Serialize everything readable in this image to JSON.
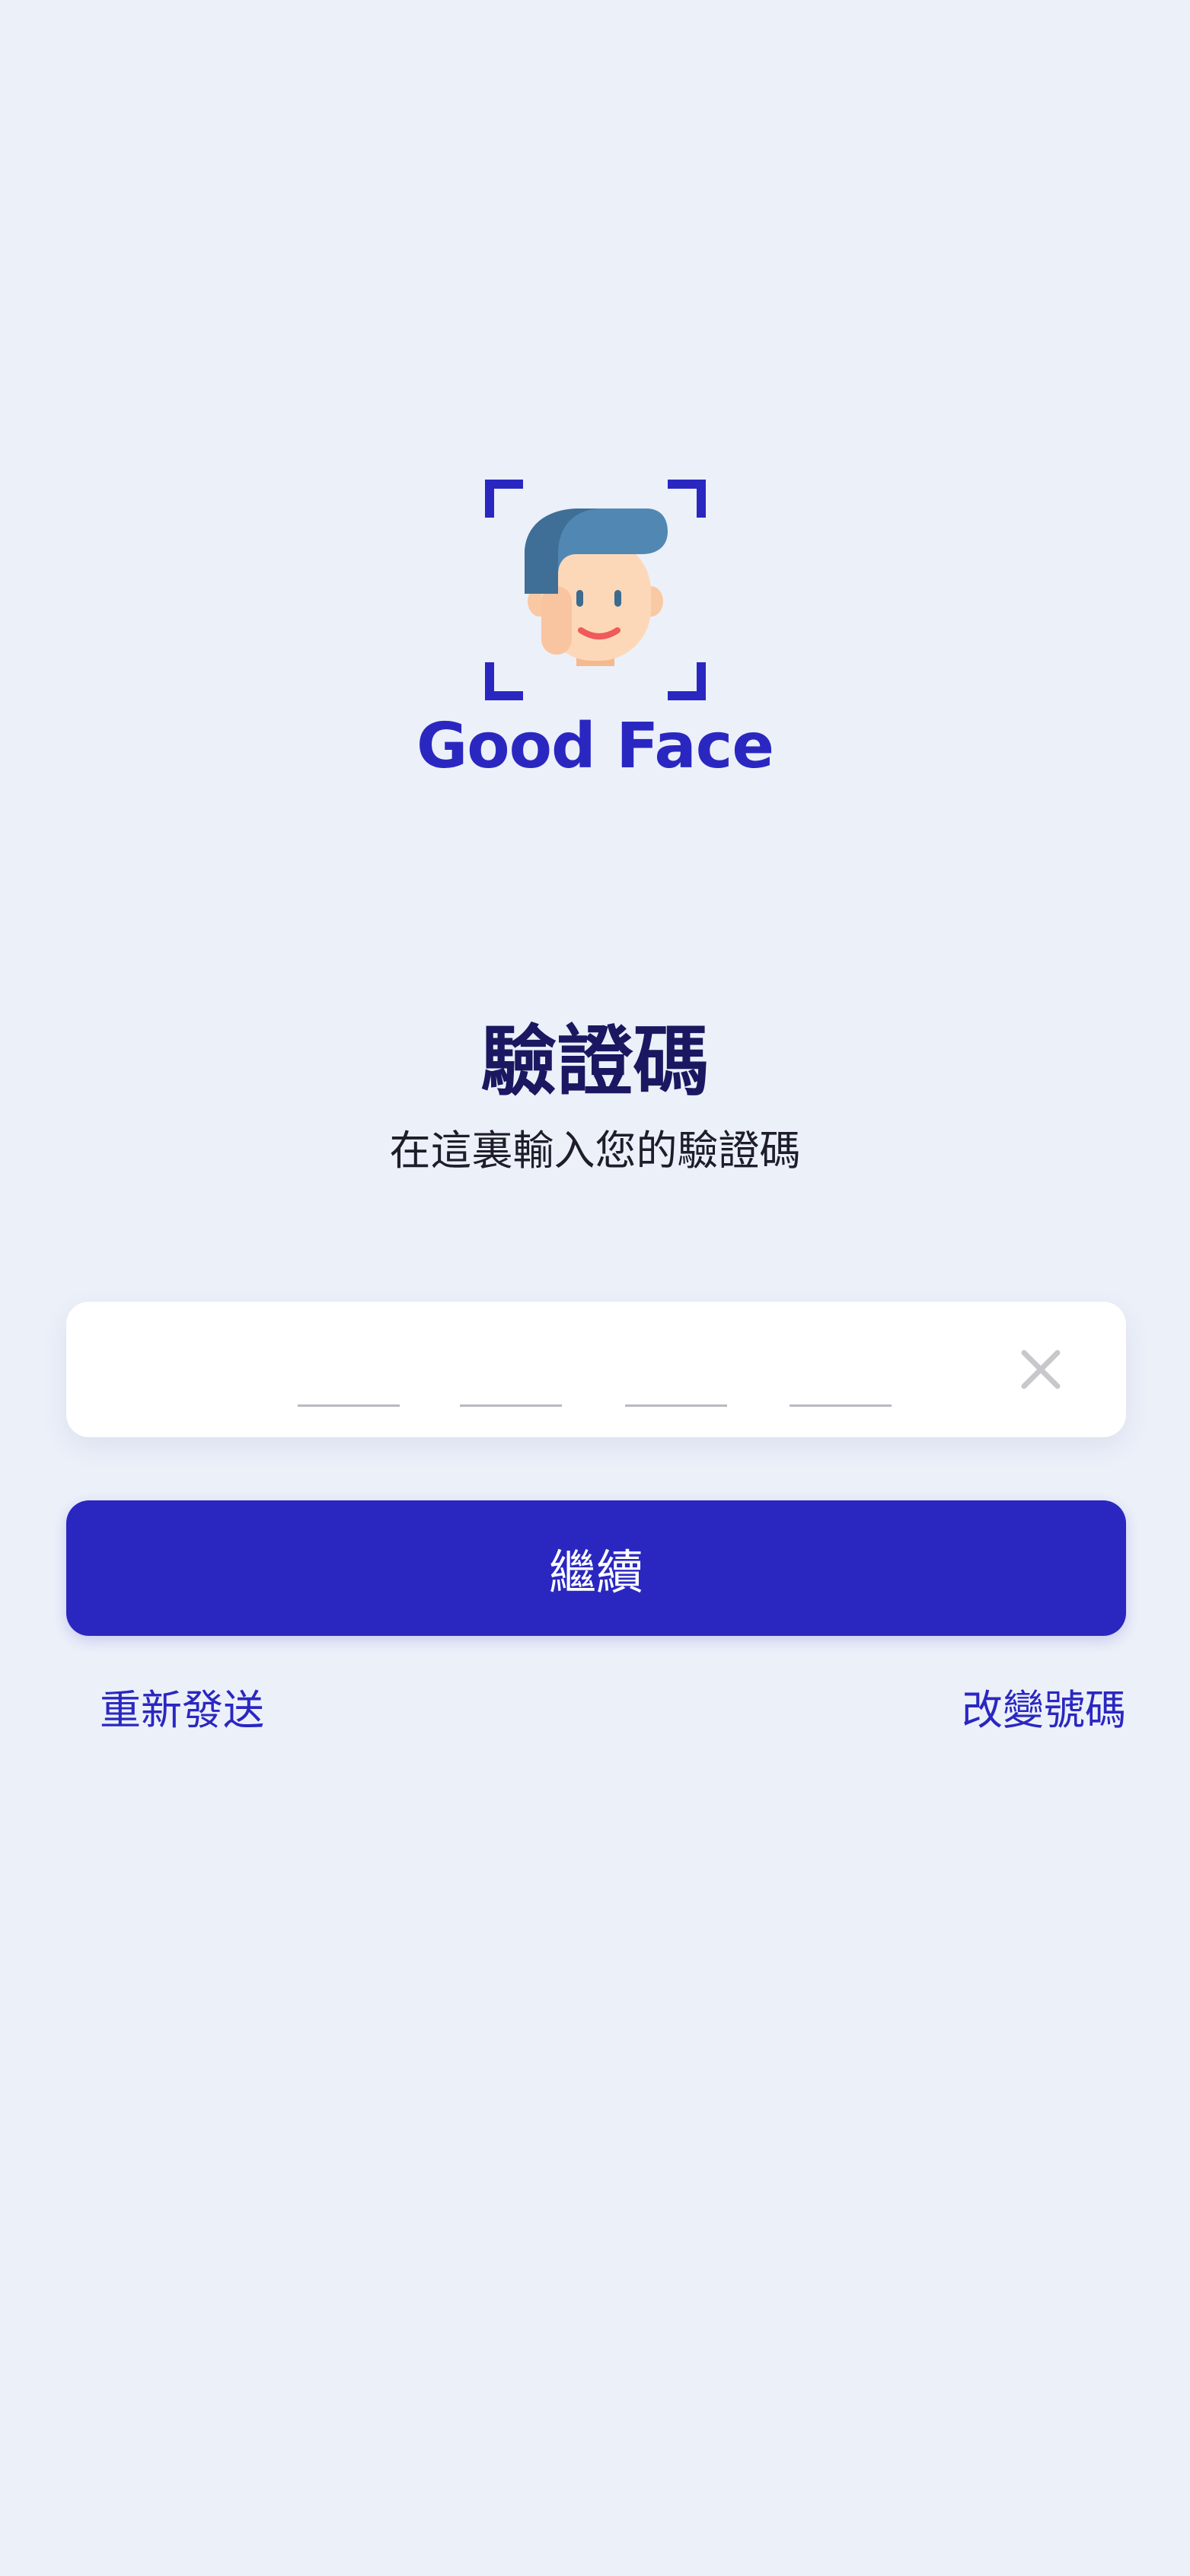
{
  "app": {
    "name": "Good Face"
  },
  "verification": {
    "title": "驗證碼",
    "subtitle": "在這裏輸入您的驗證碼"
  },
  "code_input": {
    "digits": [
      "",
      "",
      "",
      ""
    ]
  },
  "actions": {
    "continue_label": "繼續",
    "resend_label": "重新發送",
    "change_number_label": "改變號碼"
  },
  "colors": {
    "background": "#ecf0f9",
    "brand": "#2a27c1",
    "title": "#1b1760"
  },
  "icons": {
    "logo": "face-scan-icon",
    "clear": "close-icon"
  }
}
